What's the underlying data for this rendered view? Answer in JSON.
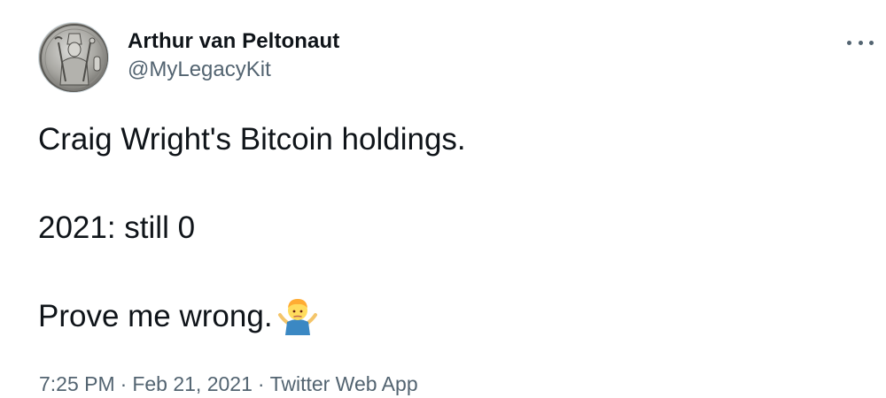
{
  "author": {
    "display_name": "Arthur van Peltonaut",
    "handle": "@MyLegacyKit",
    "avatar_icon": "silver-coin-pharaoh-icon"
  },
  "tweet": {
    "lines": [
      "Craig Wright's Bitcoin holdings.",
      "",
      "2021: still 0",
      "",
      "Prove me wrong."
    ],
    "emoji": "man-shrugging-emoji"
  },
  "meta": {
    "time": "7:25 PM",
    "separator": "·",
    "date": "Feb 21, 2021",
    "source": "Twitter Web App"
  },
  "colors": {
    "text": "#0f1419",
    "secondary": "#536471",
    "background": "#ffffff"
  }
}
